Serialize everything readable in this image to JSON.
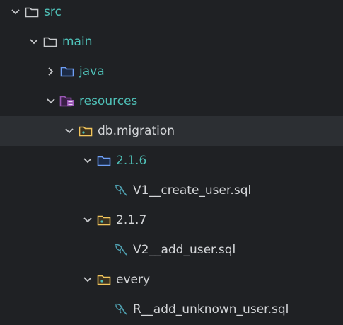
{
  "tree": {
    "src": {
      "label": "src"
    },
    "main": {
      "label": "main"
    },
    "java": {
      "label": "java"
    },
    "resources": {
      "label": "resources"
    },
    "db_migration": {
      "label": "db.migration"
    },
    "v216": {
      "label": "2.1.6"
    },
    "file1": {
      "label": "V1__create_user.sql"
    },
    "v217": {
      "label": "2.1.7"
    },
    "file2": {
      "label": "V2__add_user.sql"
    },
    "every": {
      "label": "every"
    },
    "file3": {
      "label": "R__add_unknown_user.sql"
    }
  },
  "icons": {
    "folder_plain": "folder-outline-icon",
    "folder_source": "source-folder-icon",
    "folder_resources": "resources-folder-icon",
    "folder_package": "package-folder-icon",
    "sql_file": "sql-file-icon",
    "chevron_down": "chevron-down-icon",
    "chevron_right": "chevron-right-icon"
  },
  "colors": {
    "background": "#1f2124",
    "selected_row": "#2c2f33",
    "folder_text": "#4fc1b8",
    "file_text": "#d4d6d9",
    "source_folder": "#6f9ff5",
    "resources_folder": "#9b59b6",
    "package_folder": "#f2c55c",
    "sql_icon": "#4fa0b0"
  }
}
